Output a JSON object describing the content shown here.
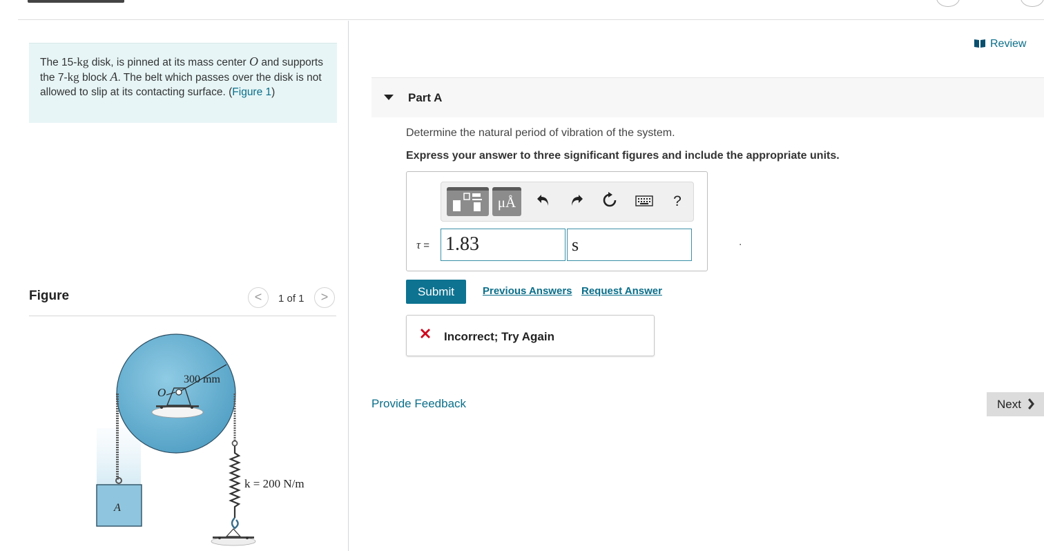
{
  "intro": {
    "t1": "The 15-",
    "kg1": "kg",
    "t2": " disk, is pinned at its mass center ",
    "o": "O",
    "t3": " and supports the 7-",
    "kg2": "kg",
    "t4": " block ",
    "a": "A",
    "t5": ". The belt which passes over the disk is not allowed to slip at its contacting surface. (",
    "figure_link": "Figure 1",
    "t6": ")"
  },
  "figure_panel": {
    "title": "Figure",
    "pager": "1 of 1",
    "prev": "<",
    "next": ">"
  },
  "figure_labels": {
    "radius": "300 mm",
    "center": "O",
    "spring": "k = 200 N/m",
    "block": "A"
  },
  "review": {
    "label": "Review"
  },
  "part": {
    "title": "Part A"
  },
  "question": "Determine the natural period of vibration of the system.",
  "instruction": "Express your answer to three significant figures and include the appropriate units.",
  "toolbar": {
    "units_label": "μÅ",
    "help_label": "?",
    "icons": [
      "templates-icon",
      "units-icon",
      "undo-icon",
      "redo-icon",
      "reset-icon",
      "keyboard-icon",
      "help-icon"
    ]
  },
  "answer": {
    "symbol": "τ",
    "equals": " =",
    "value": "1.83",
    "unit": "s"
  },
  "stray_mark": ".",
  "actions": {
    "submit": "Submit",
    "previous_answers": "Previous Answers",
    "request_answer": "Request Answer"
  },
  "feedback": {
    "message": "Incorrect; Try Again"
  },
  "footer": {
    "provide_feedback": "Provide Feedback",
    "next": "Next"
  },
  "colors": {
    "accent": "#0e7391",
    "link": "#0a6e8a",
    "intro_bg": "#e7f5f6",
    "error": "#d0021b",
    "disk": "#6fb3d2"
  }
}
